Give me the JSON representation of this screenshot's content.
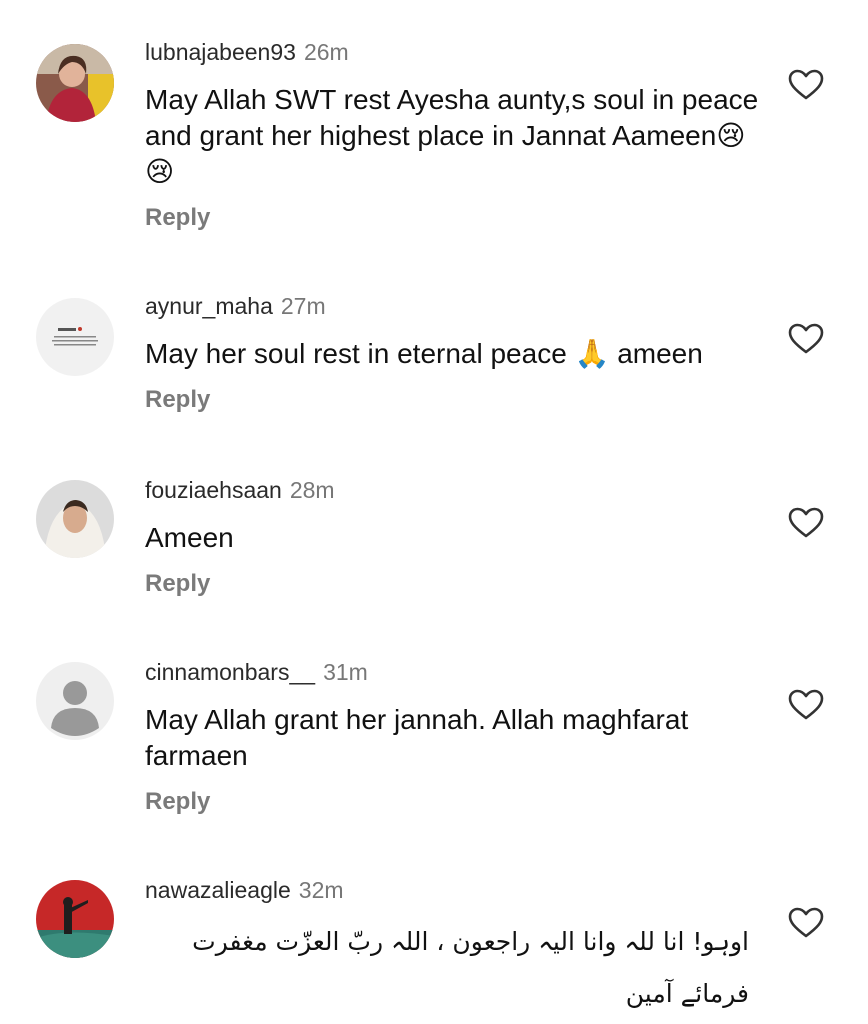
{
  "comments": [
    {
      "username": "lubnajabeen93",
      "time": "26m",
      "text": "May Allah SWT rest Ayesha aunty,s soul in peace and grant her highest place in Jannat Aameen😢😢",
      "reply_label": "Reply",
      "like_icon": "heart-outline-icon"
    },
    {
      "username": "aynur_maha",
      "time": "27m",
      "text": "May her soul rest in eternal peace 🙏 ameen",
      "reply_label": "Reply",
      "like_icon": "heart-outline-icon"
    },
    {
      "username": "fouziaehsaan",
      "time": "28m",
      "text": "Ameen",
      "reply_label": "Reply",
      "like_icon": "heart-outline-icon"
    },
    {
      "username": "cinnamonbars__",
      "time": "31m",
      "text": "May Allah grant her jannah. Allah maghfarat farmaen",
      "reply_label": "Reply",
      "like_icon": "heart-outline-icon"
    },
    {
      "username": "nawazalieagle",
      "time": "32m",
      "text": "اوہو! انا للہ وانا الیہ راجعون ، اللہ ربّ العزّت مغفرت فرمائے آمین",
      "like_icon": "heart-outline-icon"
    }
  ],
  "colors": {
    "username": "#2a2a2a",
    "time": "#777777",
    "reply": "#7a7a7a",
    "text": "#111111",
    "heart_stroke": "#333333"
  }
}
